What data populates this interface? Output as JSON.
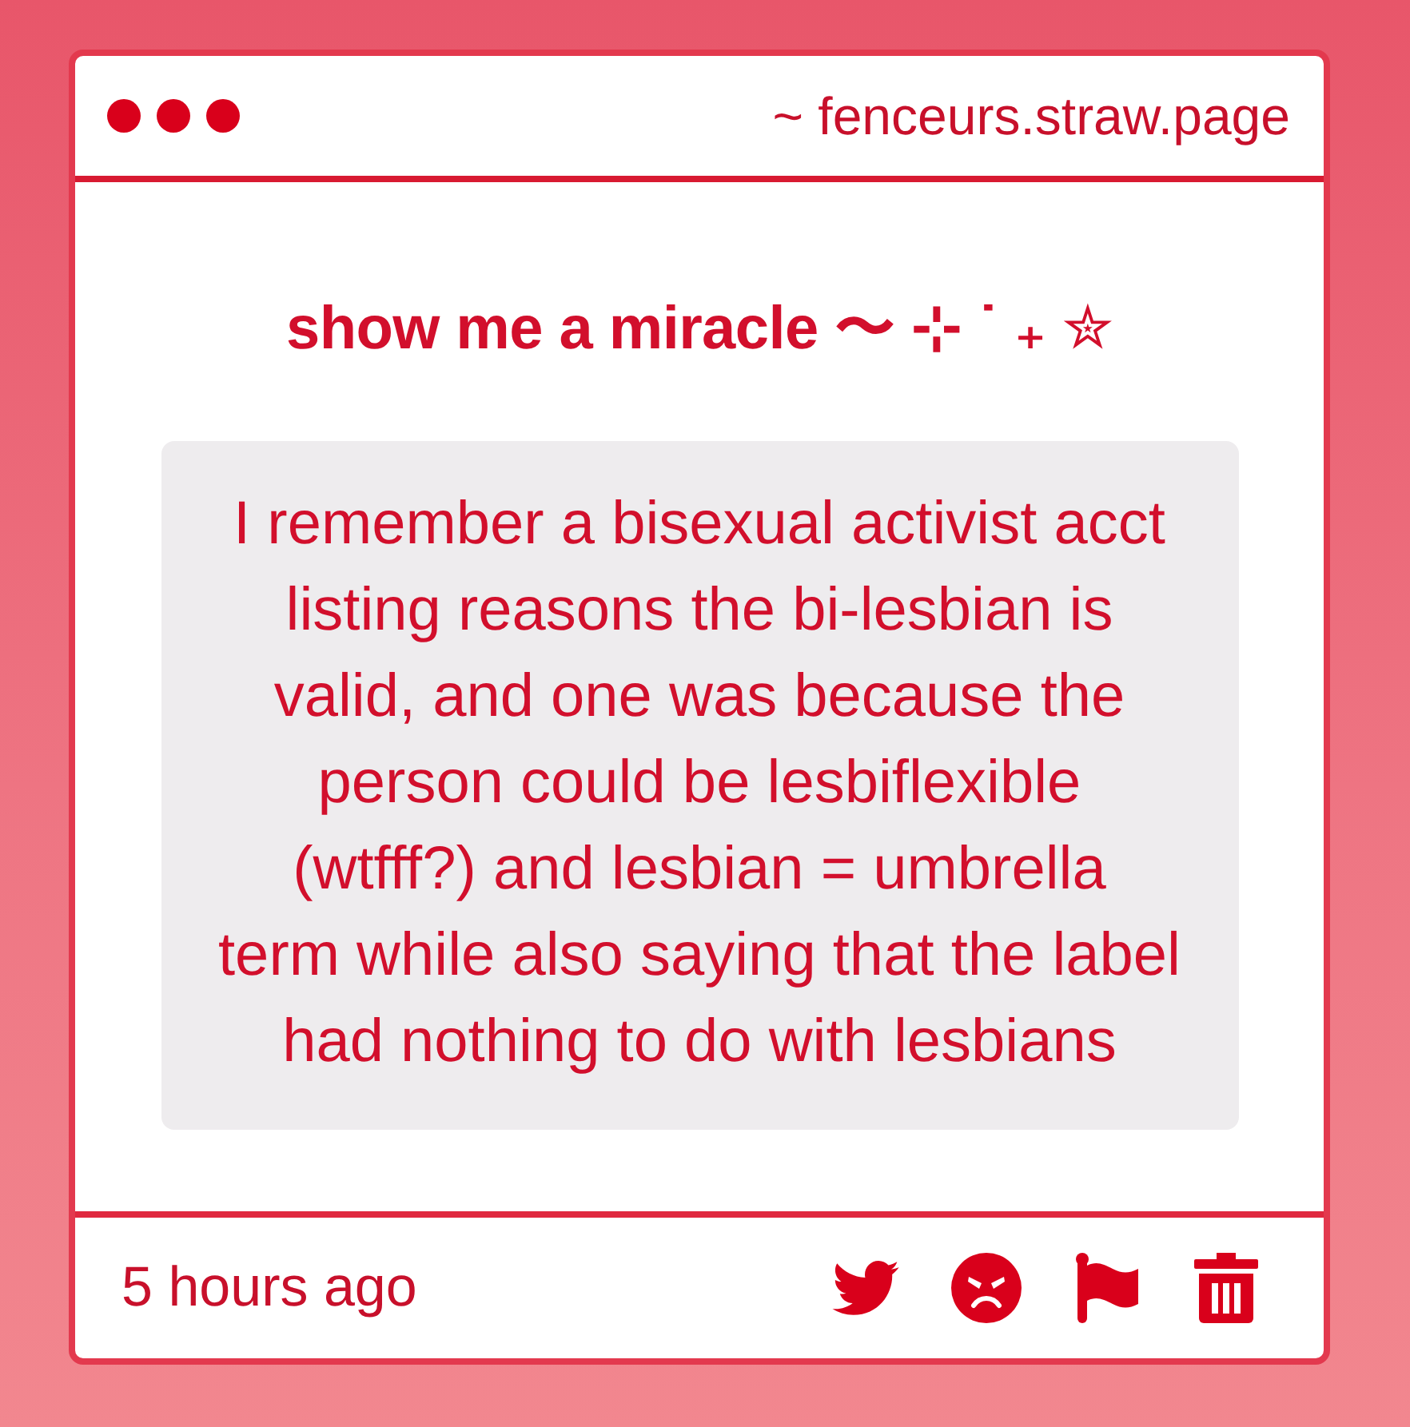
{
  "window": {
    "url": "~ fenceurs.straw.page"
  },
  "post": {
    "title": "show me a miracle 〜 ⊹ ˙ ₊ ✮",
    "message_lines": [
      "I remember a bisexual activist acct",
      "listing reasons the bi-lesbian is",
      "valid, and one was because the",
      "person could be lesbiflexible",
      "(wtfff?) and lesbian = umbrella",
      "term while also saying that the label",
      "had nothing to do with lesbians"
    ]
  },
  "footer": {
    "time": "5 hours ago",
    "actions": [
      {
        "kind": "twitter"
      },
      {
        "kind": "angry"
      },
      {
        "kind": "flag"
      },
      {
        "kind": "delete"
      }
    ]
  }
}
